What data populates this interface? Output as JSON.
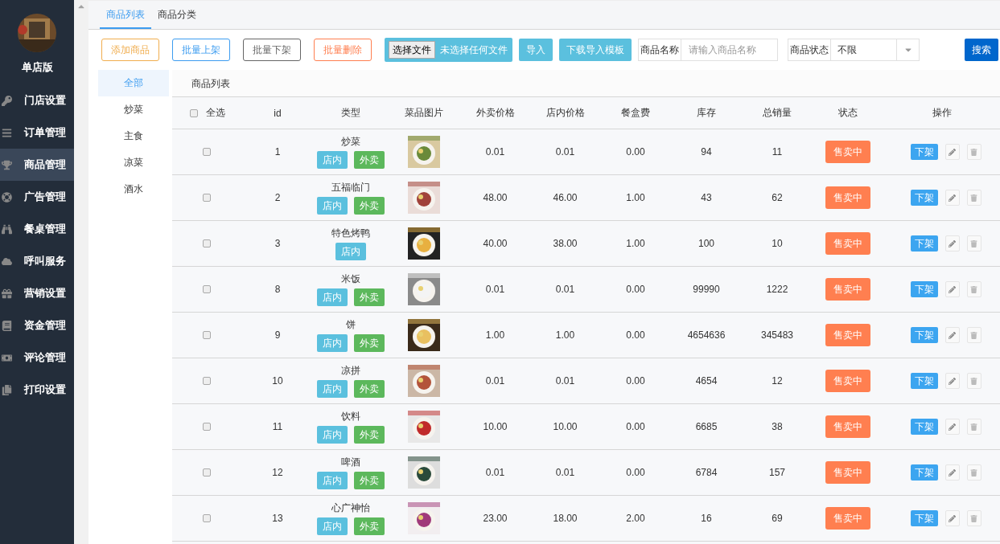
{
  "sidebar": {
    "store_name": "单店版",
    "items": [
      {
        "label": "门店设置",
        "selected": false
      },
      {
        "label": "订单管理",
        "selected": false
      },
      {
        "label": "商品管理",
        "selected": true
      },
      {
        "label": "广告管理",
        "selected": false
      },
      {
        "label": "餐桌管理",
        "selected": false
      },
      {
        "label": "呼叫服务",
        "selected": false
      },
      {
        "label": "营销设置",
        "selected": false
      },
      {
        "label": "资金管理",
        "selected": false
      },
      {
        "label": "评论管理",
        "selected": false
      },
      {
        "label": "打印设置",
        "selected": false
      }
    ]
  },
  "tabs": [
    {
      "label": "商品列表",
      "selected": true
    },
    {
      "label": "商品分类",
      "selected": false
    }
  ],
  "toolbar": {
    "buttons": [
      {
        "label": "添加商品",
        "color": "#f0ad4e"
      },
      {
        "label": "批量上架",
        "color": "#3c9cf0"
      },
      {
        "label": "批量下架",
        "color": "#666666"
      },
      {
        "label": "批量删除",
        "color": "#ff7f50"
      }
    ],
    "file_button": "选择文件",
    "file_status": "未选择任何文件",
    "import_button": "导入",
    "template_button": "下载导入模板",
    "name_label": "商品名称",
    "name_placeholder": "请输入商品名称",
    "status_label": "商品状态",
    "status_value": "不限",
    "search_button": "搜索"
  },
  "categories": [
    {
      "label": "全部",
      "selected": true
    },
    {
      "label": "炒菜",
      "selected": false
    },
    {
      "label": "主食",
      "selected": false
    },
    {
      "label": "凉菜",
      "selected": false
    },
    {
      "label": "酒水",
      "selected": false
    }
  ],
  "table": {
    "title": "商品列表",
    "select_all": "全选",
    "select_all_checked": false,
    "columns": [
      "id",
      "类型",
      "菜品图片",
      "外卖价格",
      "店内价格",
      "餐盒费",
      "库存",
      "总销量",
      "状态",
      "操作"
    ],
    "rows": [
      {
        "checked": false,
        "id": "1",
        "type": "炒菜",
        "tags": [
          {
            "kind": "dinein",
            "label": "店内"
          },
          {
            "kind": "takeout",
            "label": "外卖"
          }
        ],
        "takeout_price": "0.01",
        "dinein_price": "0.01",
        "box_fee": "0.00",
        "stock": "94",
        "sales": "11",
        "status": "售卖中",
        "action": "下架"
      },
      {
        "checked": false,
        "id": "2",
        "type": "五福临门",
        "tags": [
          {
            "kind": "dinein",
            "label": "店内"
          },
          {
            "kind": "takeout",
            "label": "外卖"
          }
        ],
        "takeout_price": "48.00",
        "dinein_price": "46.00",
        "box_fee": "1.00",
        "stock": "43",
        "sales": "62",
        "status": "售卖中",
        "action": "下架"
      },
      {
        "checked": false,
        "id": "3",
        "type": "特色烤鸭",
        "tags": [
          {
            "kind": "dinein",
            "label": "店内"
          }
        ],
        "takeout_price": "40.00",
        "dinein_price": "38.00",
        "box_fee": "1.00",
        "stock": "100",
        "sales": "10",
        "status": "售卖中",
        "action": "下架"
      },
      {
        "checked": false,
        "id": "8",
        "type": "米饭",
        "tags": [
          {
            "kind": "dinein",
            "label": "店内"
          },
          {
            "kind": "takeout",
            "label": "外卖"
          }
        ],
        "takeout_price": "0.01",
        "dinein_price": "0.01",
        "box_fee": "0.00",
        "stock": "99990",
        "sales": "1222",
        "status": "售卖中",
        "action": "下架"
      },
      {
        "checked": false,
        "id": "9",
        "type": "饼",
        "tags": [
          {
            "kind": "dinein",
            "label": "店内"
          },
          {
            "kind": "takeout",
            "label": "外卖"
          }
        ],
        "takeout_price": "1.00",
        "dinein_price": "1.00",
        "box_fee": "0.00",
        "stock": "4654636",
        "sales": "345483",
        "status": "售卖中",
        "action": "下架"
      },
      {
        "checked": false,
        "id": "10",
        "type": "凉拼",
        "tags": [
          {
            "kind": "dinein",
            "label": "店内"
          },
          {
            "kind": "takeout",
            "label": "外卖"
          }
        ],
        "takeout_price": "0.01",
        "dinein_price": "0.01",
        "box_fee": "0.00",
        "stock": "4654",
        "sales": "12",
        "status": "售卖中",
        "action": "下架"
      },
      {
        "checked": false,
        "id": "11",
        "type": "饮料",
        "tags": [
          {
            "kind": "dinein",
            "label": "店内"
          },
          {
            "kind": "takeout",
            "label": "外卖"
          }
        ],
        "takeout_price": "10.00",
        "dinein_price": "10.00",
        "box_fee": "0.00",
        "stock": "6685",
        "sales": "38",
        "status": "售卖中",
        "action": "下架"
      },
      {
        "checked": false,
        "id": "12",
        "type": "啤酒",
        "tags": [
          {
            "kind": "dinein",
            "label": "店内"
          },
          {
            "kind": "takeout",
            "label": "外卖"
          }
        ],
        "takeout_price": "0.01",
        "dinein_price": "0.01",
        "box_fee": "0.00",
        "stock": "6784",
        "sales": "157",
        "status": "售卖中",
        "action": "下架"
      },
      {
        "checked": false,
        "id": "13",
        "type": "心广神怡",
        "tags": [
          {
            "kind": "dinein",
            "label": "店内"
          },
          {
            "kind": "takeout",
            "label": "外卖"
          }
        ],
        "takeout_price": "23.00",
        "dinein_price": "18.00",
        "box_fee": "2.00",
        "stock": "16",
        "sales": "69",
        "status": "售卖中",
        "action": "下架"
      }
    ]
  }
}
